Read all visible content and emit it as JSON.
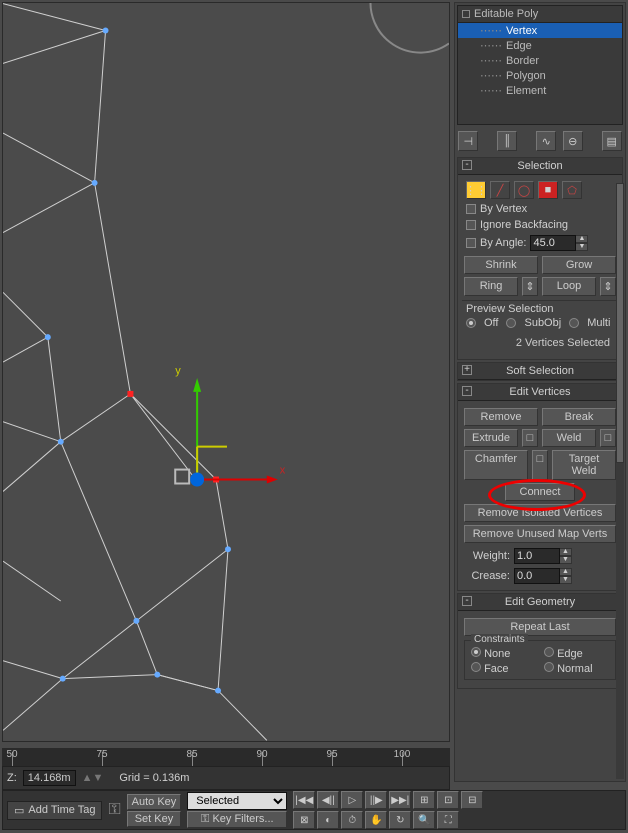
{
  "modifier_stack": {
    "header": "Editable Poly",
    "items": [
      {
        "label": "Vertex",
        "selected": true
      },
      {
        "label": "Edge",
        "selected": false
      },
      {
        "label": "Border",
        "selected": false
      },
      {
        "label": "Polygon",
        "selected": false
      },
      {
        "label": "Element",
        "selected": false
      }
    ]
  },
  "toolbar_icons": [
    "pin-icon",
    "separator",
    "lock-icon",
    "separator",
    "curve-icon",
    "bulb-icon",
    "separator",
    "configure-icon"
  ],
  "selection": {
    "title": "Selection",
    "by_vertex": "By Vertex",
    "ignore_backfacing": "Ignore Backfacing",
    "by_angle": "By Angle:",
    "angle_value": "45.0",
    "shrink": "Shrink",
    "grow": "Grow",
    "ring": "Ring",
    "loop": "Loop",
    "preview_label": "Preview Selection",
    "preview_off": "Off",
    "preview_subobj": "SubObj",
    "preview_multi": "Multi",
    "status": "2 Vertices Selected"
  },
  "soft_selection": {
    "title": "Soft Selection"
  },
  "edit_vertices": {
    "title": "Edit Vertices",
    "remove": "Remove",
    "break": "Break",
    "extrude": "Extrude",
    "weld": "Weld",
    "chamfer": "Chamfer",
    "target_weld": "Target Weld",
    "connect": "Connect",
    "remove_isolated": "Remove Isolated Vertices",
    "remove_unused": "Remove Unused Map Verts",
    "weight_label": "Weight:",
    "weight_value": "1.0",
    "crease_label": "Crease:",
    "crease_value": "0.0"
  },
  "edit_geometry": {
    "title": "Edit Geometry",
    "repeat_last": "Repeat Last",
    "constraints_label": "Constraints",
    "c_none": "None",
    "c_edge": "Edge",
    "c_face": "Face",
    "c_normal": "Normal"
  },
  "ruler": {
    "ticks": [
      50,
      75,
      85,
      90,
      95,
      100
    ],
    "labels": [
      "50",
      "75",
      "85",
      "90",
      "95",
      "100"
    ]
  },
  "status": {
    "z_label": "Z:",
    "z_value": "14.168m",
    "grid": "Grid = 0.136m"
  },
  "bottom": {
    "add_time_tag": "Add Time Tag",
    "auto_key": "Auto Key",
    "set_key": "Set Key",
    "selected": "Selected",
    "key_filters": "Key Filters..."
  },
  "gizmo": {
    "x": "x",
    "y": "y"
  }
}
